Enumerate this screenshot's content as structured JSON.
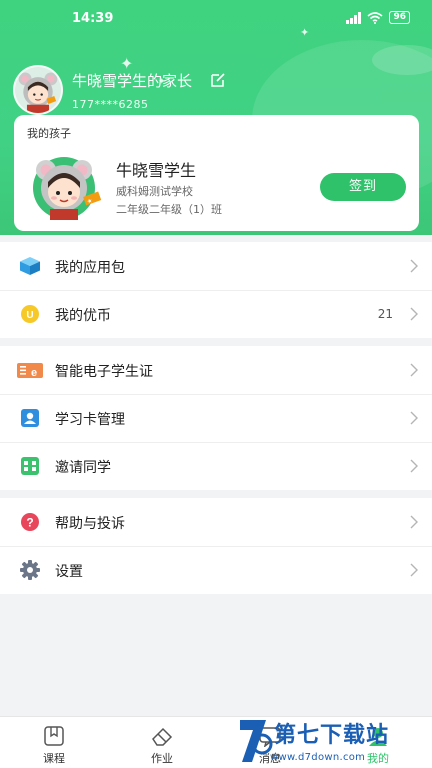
{
  "status_bar": {
    "time": "14:39",
    "battery": "96"
  },
  "parent": {
    "name": "牛晓雪学生的家长",
    "phone": "177****6285"
  },
  "child_card": {
    "title": "我的孩子",
    "name": "牛晓雪学生",
    "school": "威科姆测试学校",
    "class": "二年级二年级（1）班",
    "checkin_label": "签到"
  },
  "menu_groups": [
    {
      "items": [
        {
          "label": "我的应用包",
          "value": "",
          "icon": "cube-icon"
        },
        {
          "label": "我的优币",
          "value": "21",
          "icon": "coin-icon"
        }
      ]
    },
    {
      "items": [
        {
          "label": "智能电子学生证",
          "value": "",
          "icon": "student-card-icon"
        },
        {
          "label": "学习卡管理",
          "value": "",
          "icon": "person-card-icon"
        },
        {
          "label": "邀请同学",
          "value": "",
          "icon": "invite-icon"
        }
      ]
    },
    {
      "items": [
        {
          "label": "帮助与投诉",
          "value": "",
          "icon": "help-icon"
        },
        {
          "label": "设置",
          "value": "",
          "icon": "gear-icon"
        }
      ]
    }
  ],
  "tabs": [
    {
      "label": "课程",
      "icon": "bookmark-book-icon"
    },
    {
      "label": "作业",
      "icon": "eraser-icon"
    },
    {
      "label": "消息",
      "icon": "message-icon"
    },
    {
      "label": "我的",
      "icon": "profile-icon"
    }
  ],
  "watermark": {
    "text": "第七下载站",
    "url": "www.d7down.com"
  },
  "colors": {
    "primary_green": "#3fd37f",
    "button_green": "#2fc26b",
    "watermark_blue": "#1a5fb4"
  }
}
